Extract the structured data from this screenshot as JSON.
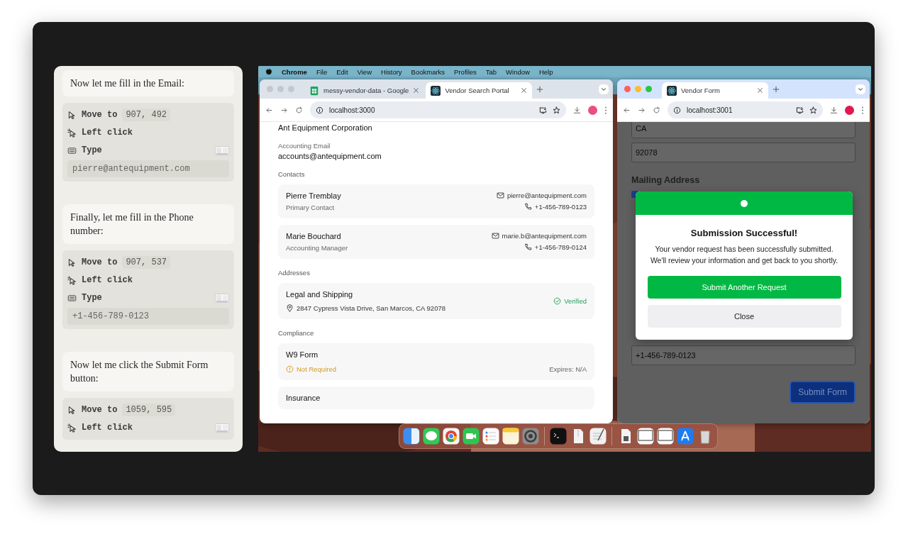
{
  "steps_panel": {
    "items": [
      {
        "kind": "message",
        "text": "Now let me fill in the Email:"
      },
      {
        "kind": "actions",
        "actions": [
          {
            "kind": "move",
            "label": "Move to",
            "coords": "907, 492"
          },
          {
            "kind": "click",
            "label": "Left click"
          },
          {
            "kind": "type",
            "label": "Type",
            "value": "pierre@antequipment.com"
          }
        ]
      },
      {
        "kind": "message",
        "text": "Finally, let me fill in the Phone number:"
      },
      {
        "kind": "actions",
        "actions": [
          {
            "kind": "move",
            "label": "Move to",
            "coords": "907, 537"
          },
          {
            "kind": "click",
            "label": "Left click"
          },
          {
            "kind": "type",
            "label": "Type",
            "value": "+1-456-789-0123"
          }
        ]
      },
      {
        "kind": "message",
        "text": "Now let me click the Submit Form button:"
      },
      {
        "kind": "actions",
        "actions": [
          {
            "kind": "move",
            "label": "Move to",
            "coords": "1059, 595"
          },
          {
            "kind": "click",
            "label": "Left click"
          }
        ]
      }
    ]
  },
  "menu_bar": {
    "app": "Chrome",
    "items": [
      "File",
      "Edit",
      "View",
      "History",
      "Bookmarks",
      "Profiles",
      "Tab",
      "Window",
      "Help"
    ]
  },
  "left_browser": {
    "active": false,
    "url": "localhost:3000",
    "tabs": [
      {
        "title": "messy-vendor-data - Google",
        "selected": false
      },
      {
        "title": "Vendor Search Portal",
        "selected": true
      }
    ],
    "page": {
      "company": "Ant Equipment Corporation",
      "accounting_email": {
        "label": "Accounting Email",
        "value": "accounts@antequipment.com"
      },
      "contacts": {
        "label": "Contacts",
        "items": [
          {
            "name": "Pierre Tremblay",
            "role": "Primary Contact",
            "email": "pierre@antequipment.com",
            "phone": "+1-456-789-0123"
          },
          {
            "name": "Marie Bouchard",
            "role": "Accounting Manager",
            "email": "marie.b@antequipment.com",
            "phone": "+1-456-789-0124"
          }
        ]
      },
      "addresses": {
        "label": "Addresses",
        "items": [
          {
            "title": "Legal and Shipping",
            "address": "2847 Cypress Vista Drive, San Marcos, CA 92078",
            "status": "Verified"
          }
        ]
      },
      "compliance": {
        "label": "Compliance",
        "items": [
          {
            "title": "W9 Form",
            "status": "Not Required",
            "expires": "Expires: N/A"
          },
          {
            "title": "Insurance"
          }
        ]
      }
    }
  },
  "right_browser": {
    "active": true,
    "url": "localhost:3001",
    "tabs": [
      {
        "title": "Vendor Form",
        "selected": true
      }
    ],
    "form": {
      "fields": [
        {
          "value": "CA"
        },
        {
          "value": "92078"
        }
      ],
      "heading": "Mailing Address",
      "checkbox": {
        "checked": true
      },
      "phone_field": {
        "value": "+1-456-789-0123"
      },
      "submit": "Submit Form"
    },
    "modal": {
      "title": "Submission Successful!",
      "message": "Your vendor request has been successfully submitted. We'll review your information and get back to you shortly.",
      "primary_button": "Submit Another Request",
      "secondary_button": "Close"
    }
  }
}
